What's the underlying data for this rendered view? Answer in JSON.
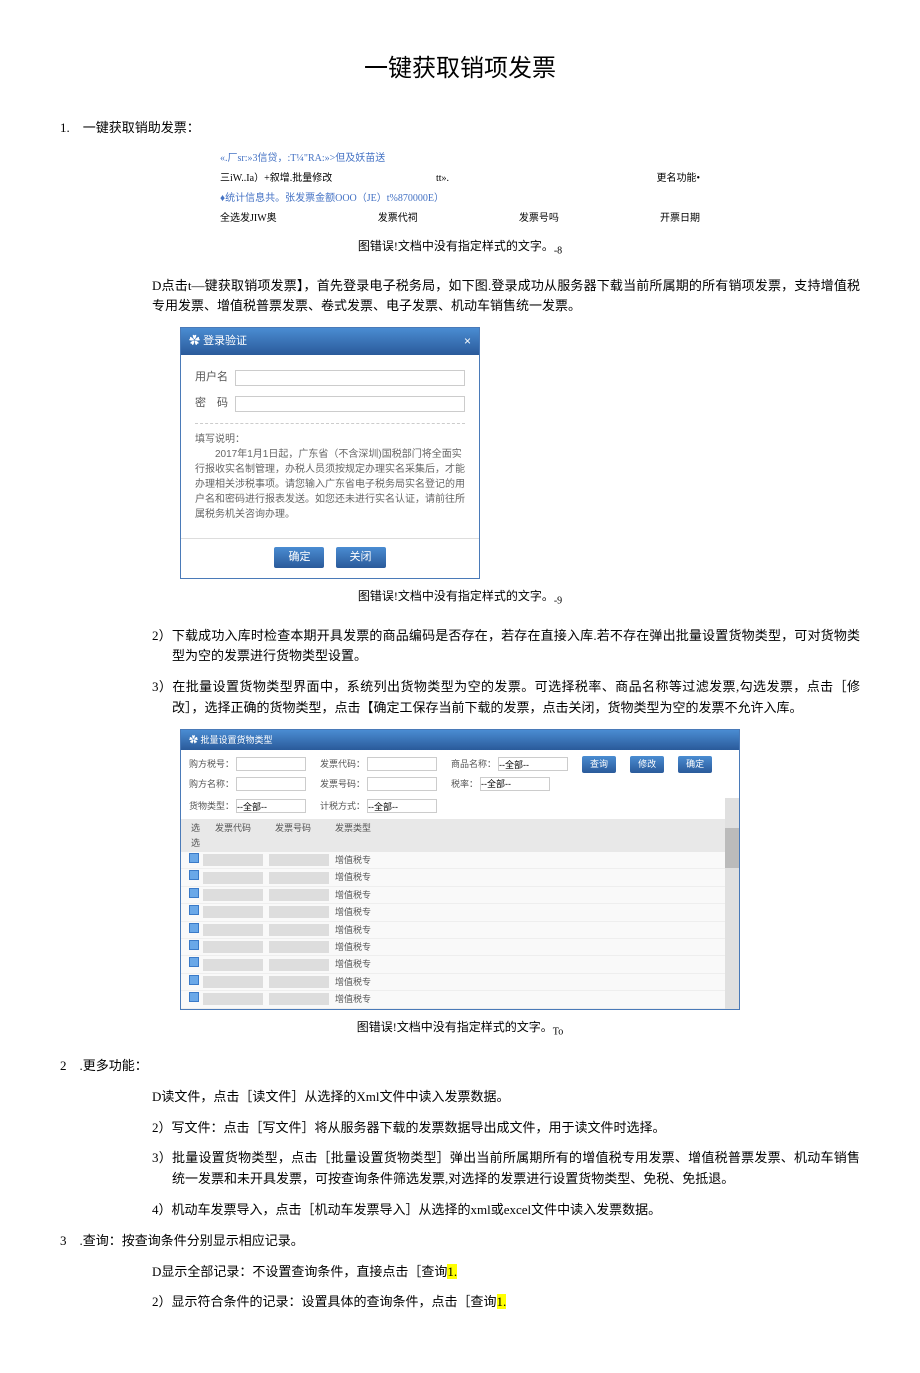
{
  "title": "一键获取销项发票",
  "sections": {
    "s1_head": "1.　一键获取销助发票：",
    "toolbar": {
      "row1a": "«.厂sr:»3信贷，:T¼\"RA:»>但及妖苗送",
      "row2a": "三iW..Ia）+叙增.批量修改",
      "row2b": "tt».",
      "row2c": "更名功能•",
      "row3a": "♦统计信息共。张发票金额OOO（JE）t%870000E）",
      "row4a": "全选发JIW奥",
      "row4b": "发票代祠",
      "row4c": "发票号吗",
      "row4d": "开票日期"
    },
    "caption_prefix": "图错误!文档中没有指定样式的文字。",
    "caption_8": "-8",
    "caption_9": "-9",
    "caption_T": "To",
    "p1a": "D点击t—键获取销项发票】，首先登录电子税务局，如下图.登录成功从服务器下载当前所属期的所有销项发票，支持增值税专用发票、增值税普票发票、卷式发票、电子发票、机动车销售统一发票。",
    "login": {
      "head_gear": "✿",
      "head_title": "登录验证",
      "close": "×",
      "user_label": "用户名",
      "pass_label": "密　码",
      "note_title": "填写说明：",
      "note_body": "2017年1月1日起，广东省（不含深圳)国税部门将全面实行报收实名制管理，办税人员须按规定办理实名采集后，才能办理相关涉税事项。请您输入广东省电子税务局实名登记的用户名和密码进行报表发送。如您还未进行实名认证，请前往所属税务机关咨询办理。",
      "btn_ok": "确定",
      "btn_close": "关闭"
    },
    "p2": "2）下载成功入库时检查本期开具发票的商品编码是否存在，若存在直接入库.若不存在弹出批量设置货物类型，可对货物类型为空的发票进行货物类型设置。",
    "p3": "3）在批量设置货物类型界面中，系统列出货物类型为空的发票。可选择税率、商品名称等过滤发票,勾选发票，点击［修改］，选择正确的货物类型，点击【确定工保存当前下载的发票，点击关闭，货物类型为空的发票不允许入库。",
    "batch": {
      "head_gear": "✿",
      "head_title": "批量设置货物类型",
      "f1_label": "购方税号：",
      "f1_ph": "",
      "f2_label": "发票代码：",
      "f2_ph": "",
      "f3_label": "商品名称：",
      "f3_ph": "--全部--",
      "f4_label": "购方名称：",
      "f4_ph": "",
      "f5_label": "发票号码：",
      "f5_ph": "",
      "f6_label": "税率：",
      "f6_ph": "--全部--",
      "f7_label": "货物类型：",
      "f7_ph": "--全部--",
      "f8_label": "计税方式：",
      "f8_ph": "--全部--",
      "btn_query": "查询",
      "btn_modify": "修改",
      "btn_determine": "确定",
      "th_sel": "选选",
      "th_code": "发票代码",
      "th_num": "发票号码",
      "th_type": "发票类型",
      "row_type": "增值税专"
    },
    "s2_head": "2　.更多功能：",
    "s2_p1": "D读文件，点击［读文件］从选择的Xml文件中读入发票数据。",
    "s2_p2": "2）写文件：点击［写文件］将从服务器下载的发票数据导出成文件，用于读文件时选择。",
    "s2_p3": "3）批量设置货物类型，点击［批量设置货物类型］弹出当前所属期所有的增值税专用发票、增值税普票发票、机动车销售统一发票和未开具发票，可按查询条件筛选发票,对选择的发票进行设置货物类型、免税、免抵退。",
    "s2_p4": "4）机动车发票导入，点击［机动车发票导入］从选择的xml或excel文件中读入发票数据。",
    "s3_head": "3　.查询：按查询条件分别显示相应记录。",
    "s3_p1_a": "D显示全部记录：不设置查询条件，直接点击［查询",
    "s3_p1_b": "1.",
    "s3_p2_a": "2）显示符合条件的记录：设置具体的查询条件，点击［查询",
    "s3_p2_b": "1."
  }
}
